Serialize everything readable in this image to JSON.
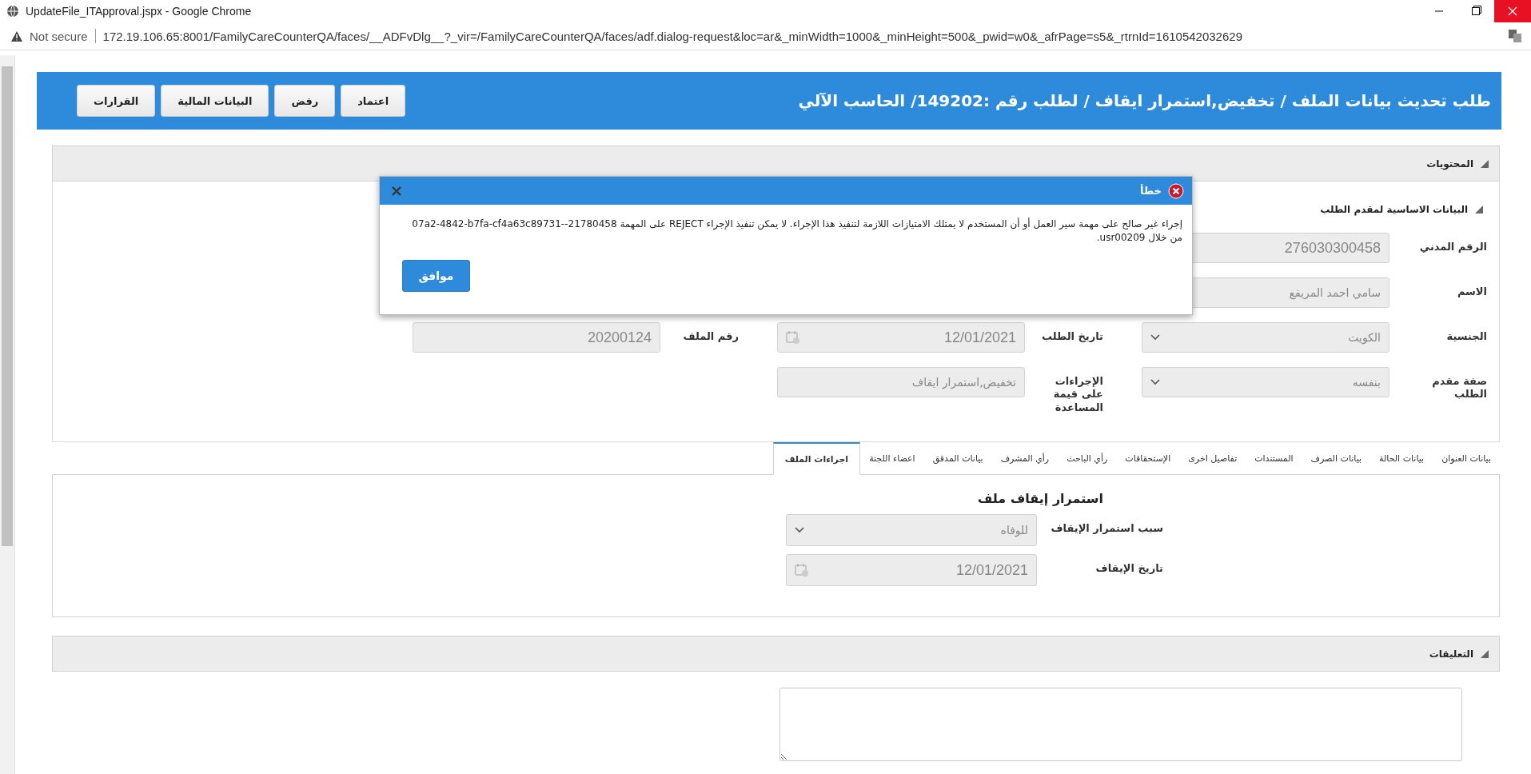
{
  "window": {
    "title": "UpdateFile_ITApproval.jspx - Google Chrome"
  },
  "address_bar": {
    "security": "Not secure",
    "url": "172.19.106.65:8001/FamilyCareCounterQA/faces/__ADFvDlg__?_vir=/FamilyCareCounterQA/faces/adf.dialog-request&loc=ar&_minWidth=1000&_minHeight=500&_pwid=w0&_afrPage=s5&_rtrnId=1610542032629"
  },
  "header": {
    "title": "طلب تحديث بيانات الملف / تخفيض,استمرار ايقاف / لطلب رقم :149202/ الحاسب الآلي",
    "buttons": [
      "اعتماد",
      "رفض",
      "البيانات المالية",
      "القرارات"
    ]
  },
  "contents_section": {
    "title": "المحتويات",
    "expanded": true,
    "subsection": {
      "title": "البيانات الاساسية لمقدم الطلب",
      "expanded": true
    },
    "rows": [
      {
        "fields": [
          {
            "label": "الرقم المدني",
            "kind": "text",
            "value": "276030300458"
          }
        ]
      },
      {
        "fields": [
          {
            "label": "الاسم",
            "kind": "text",
            "value": "سامي احمد المريفع"
          }
        ]
      },
      {
        "fields": [
          {
            "label": "الجنسية",
            "kind": "select",
            "value": "الكويت"
          },
          {
            "label": "تاريخ الطلب",
            "kind": "date",
            "value": "12/01/2021"
          },
          {
            "label": "رقم الملف",
            "kind": "text",
            "value": "20200124"
          }
        ]
      },
      {
        "fields": [
          {
            "label": "صفة مقدم الطلب",
            "kind": "select",
            "value": "بنفسه"
          },
          {
            "label": "الإجراءات على قيمة المساعدة",
            "kind": "text",
            "value": "تخفيض,استمرار ايقاف"
          }
        ]
      }
    ]
  },
  "tabs": [
    {
      "label": "بيانات العنوان",
      "selected": false
    },
    {
      "label": "بيانات الحالة",
      "selected": false
    },
    {
      "label": "بيانات الصرف",
      "selected": false
    },
    {
      "label": "المستندات",
      "selected": false
    },
    {
      "label": "تفاصيل اخرى",
      "selected": false
    },
    {
      "label": "الإستحقاقات",
      "selected": false
    },
    {
      "label": "رأي الباحث",
      "selected": false
    },
    {
      "label": "رأي المشرف",
      "selected": false
    },
    {
      "label": "بيانات المدقق",
      "selected": false
    },
    {
      "label": "اعضاء اللجنة",
      "selected": false
    },
    {
      "label": "اجراءات الملف",
      "selected": true
    }
  ],
  "tab_panel": {
    "heading": "استمرار إيقاف ملف",
    "fields": [
      {
        "label": "سبب استمرار الإيقاف",
        "kind": "select",
        "value": "للوفاه"
      },
      {
        "label": "تاريخ الإيقاف",
        "kind": "date",
        "value": "12/01/2021"
      }
    ]
  },
  "comments_section": {
    "title": "التعليقات",
    "expanded": true
  },
  "dialog": {
    "title": "خطأ",
    "message": "إجراء غير صالح على مهمة سير العمل أو أن المستخدم لا يمتلك الامتيازات اللازمة لتنفيذ هذا الإجراء. لا يمكن تنفيذ الإجراء REJECT على المهمة 21780458--07a2-4842-b7fa-cf4a63c89731 من خلال usr00209.",
    "button": "موافق"
  }
}
